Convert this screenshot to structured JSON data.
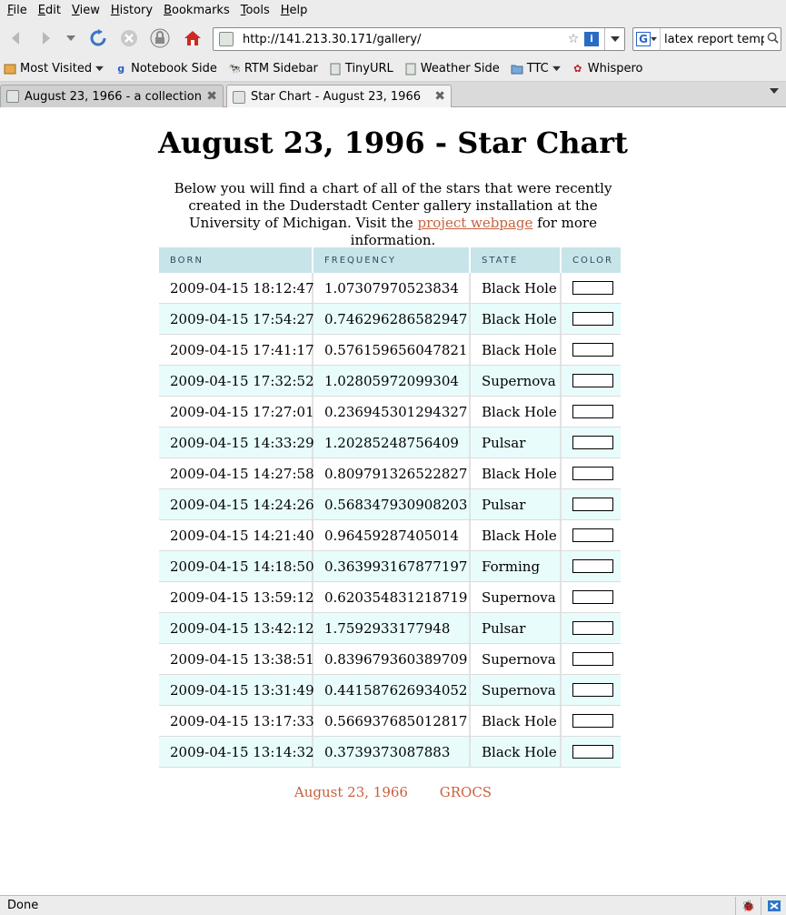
{
  "menu": [
    {
      "label": "File",
      "key": "F",
      "rest": "ile"
    },
    {
      "label": "Edit",
      "key": "E",
      "rest": "dit"
    },
    {
      "label": "View",
      "key": "V",
      "rest": "iew"
    },
    {
      "label": "History",
      "key": "H",
      "rest": "istory"
    },
    {
      "label": "Bookmarks",
      "key": "B",
      "rest": "ookmarks"
    },
    {
      "label": "Tools",
      "key": "T",
      "rest": "ools"
    },
    {
      "label": "Help",
      "key": "H",
      "rest": "elp"
    }
  ],
  "navigation": {
    "url": "http://141.213.30.171/gallery/",
    "search_query": "latex report temp"
  },
  "bookmarks": [
    {
      "label": "Most Visited",
      "icon": "most-visited-icon"
    },
    {
      "label": "Notebook Side",
      "icon": "notebook-icon"
    },
    {
      "label": "RTM Sidebar",
      "icon": "rtm-icon"
    },
    {
      "label": "TinyURL",
      "icon": "page-icon"
    },
    {
      "label": "Weather Side",
      "icon": "page-icon"
    },
    {
      "label": "TTC",
      "icon": "folder-icon"
    },
    {
      "label": "Whispero",
      "icon": "whispero-icon"
    }
  ],
  "tabs": [
    {
      "title": "August 23, 1966 - a collection..."
    },
    {
      "title": "Star Chart - August 23, 1966"
    }
  ],
  "page": {
    "title": "August 23, 1996 - Star Chart",
    "intro_before": "Below you will find a chart of all of the stars that were recently created in the Duderstadt Center gallery installation at the University of Michigan. Visit the ",
    "intro_link": "project webpage",
    "intro_after": " for more information.",
    "link_color": "#c7613d",
    "header_color": "#c7e4e8",
    "alt_row_color": "#e8fcfc"
  },
  "table": {
    "columns": [
      "BORN",
      "FREQUENCY",
      "STATE",
      "COLOR"
    ],
    "rows": [
      {
        "born": "2009-04-15 18:12:47",
        "frequency": "1.07307970523834",
        "state": "Black Hole"
      },
      {
        "born": "2009-04-15 17:54:27",
        "frequency": "0.746296286582947",
        "state": "Black Hole"
      },
      {
        "born": "2009-04-15 17:41:17",
        "frequency": "0.576159656047821",
        "state": "Black Hole"
      },
      {
        "born": "2009-04-15 17:32:52",
        "frequency": "1.02805972099304",
        "state": "Supernova"
      },
      {
        "born": "2009-04-15 17:27:01",
        "frequency": "0.236945301294327",
        "state": "Black Hole"
      },
      {
        "born": "2009-04-15 14:33:29",
        "frequency": "1.20285248756409",
        "state": "Pulsar"
      },
      {
        "born": "2009-04-15 14:27:58",
        "frequency": "0.809791326522827",
        "state": "Black Hole"
      },
      {
        "born": "2009-04-15 14:24:26",
        "frequency": "0.568347930908203",
        "state": "Pulsar"
      },
      {
        "born": "2009-04-15 14:21:40",
        "frequency": "0.96459287405014",
        "state": "Black Hole"
      },
      {
        "born": "2009-04-15 14:18:50",
        "frequency": "0.363993167877197",
        "state": "Forming"
      },
      {
        "born": "2009-04-15 13:59:12",
        "frequency": "0.620354831218719",
        "state": "Supernova"
      },
      {
        "born": "2009-04-15 13:42:12",
        "frequency": "1.7592933177948",
        "state": "Pulsar"
      },
      {
        "born": "2009-04-15 13:38:51",
        "frequency": "0.839679360389709",
        "state": "Supernova"
      },
      {
        "born": "2009-04-15 13:31:49",
        "frequency": "0.441587626934052",
        "state": "Supernova"
      },
      {
        "born": "2009-04-15 13:17:33",
        "frequency": "0.566937685012817",
        "state": "Black Hole"
      },
      {
        "born": "2009-04-15 13:14:32",
        "frequency": "0.3739373087883",
        "state": "Black Hole"
      }
    ]
  },
  "footer": {
    "links": [
      "August 23, 1966",
      "GROCS"
    ]
  },
  "status": {
    "text": "Done"
  }
}
